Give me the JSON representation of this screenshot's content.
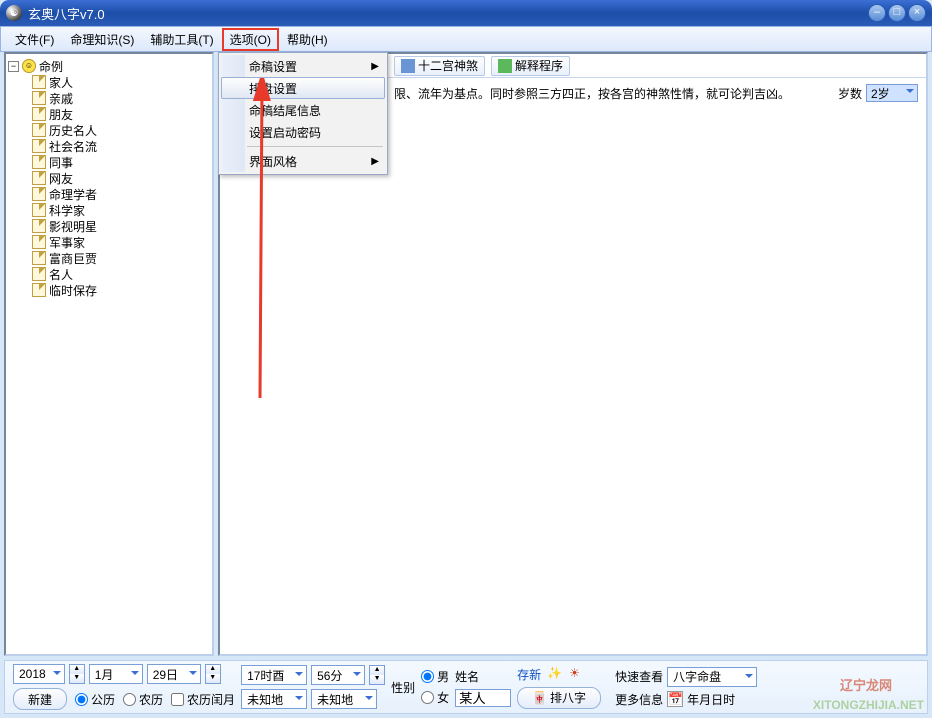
{
  "title": "玄奥八字v7.0",
  "menubar": [
    "文件(F)",
    "命理知识(S)",
    "辅助工具(T)",
    "选项(O)",
    "帮助(H)"
  ],
  "menubar_highlight_idx": 3,
  "dropdown": {
    "items": [
      {
        "label": "命稿设置",
        "submenu": true
      },
      {
        "label": "排盘设置",
        "selected": true
      },
      {
        "label": "命稿结尾信息"
      },
      {
        "label": "设置启动密码"
      },
      {
        "sep": true
      },
      {
        "label": "界面风格",
        "submenu": true
      }
    ]
  },
  "tree": {
    "root": "命例",
    "children": [
      "家人",
      "亲戚",
      "朋友",
      "历史名人",
      "社会名流",
      "同事",
      "网友",
      "命理学者",
      "科学家",
      "影视明星",
      "军事家",
      "富商巨贾",
      "名人",
      "临时保存"
    ]
  },
  "content": {
    "buttons": [
      {
        "icon": "grid-icon",
        "label": "十二宫神煞"
      },
      {
        "icon": "refresh-icon",
        "label": "解释程序"
      }
    ],
    "infoline_text": "限、流年为基点。同时参照三方四正，按各宫的神煞性情，就可论判吉凶。",
    "age_label": "岁数",
    "age_value": "2岁"
  },
  "bottom": {
    "year": "2018",
    "month": "1月",
    "day": "29日",
    "hour": "17时酉",
    "minute": "56分",
    "new_btn": "新建",
    "cal_solar": "公历",
    "cal_lunar": "农历",
    "leap": "农历闰月",
    "loc1": "未知地",
    "loc2": "未知地",
    "gender_label": "性别",
    "male": "男",
    "female": "女",
    "name_label": "姓名",
    "name_value": "某人",
    "save": "存新",
    "paiba": "排八字",
    "quick_label": "快速查看",
    "quick_value": "八字命盘",
    "more_label": "更多信息",
    "more_link": "年月日时"
  },
  "winbtns": {
    "min": "–",
    "max": "□",
    "close": "×"
  },
  "watermark": "XITONGZHIJIA.NET",
  "watermark_red": "辽宁龙网"
}
